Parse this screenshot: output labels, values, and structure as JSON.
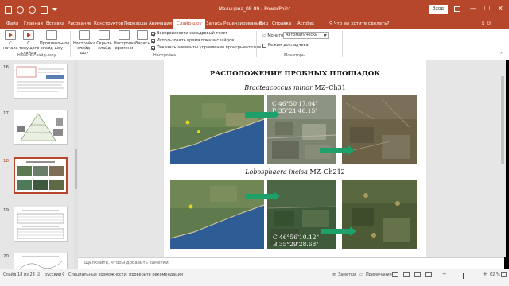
{
  "window": {
    "title": "Мальцева_08.09  -  PowerPoint",
    "signin_label": "Вход",
    "minimize": "—",
    "maximize": "☐",
    "close": "✕"
  },
  "tabs": [
    {
      "label": "Файл"
    },
    {
      "label": "Главная"
    },
    {
      "label": "Вставка"
    },
    {
      "label": "Рисование"
    },
    {
      "label": "Конструктор"
    },
    {
      "label": "Переходы"
    },
    {
      "label": "Анимация"
    },
    {
      "label": "Слайд-шоу",
      "active": true
    },
    {
      "label": "Запись"
    },
    {
      "label": "Рецензирование"
    },
    {
      "label": "Вид"
    },
    {
      "label": "Справка"
    },
    {
      "label": "Acrobat"
    }
  ],
  "tell_me": "Что вы хотите сделать?",
  "ribbon": {
    "start_group": {
      "label": "Начать слайд-шоу",
      "from_start": "С начала",
      "from_current": "С текущего слайда",
      "custom": "Произвольное слайд-шоу"
    },
    "setup_group": {
      "label": "Настройка",
      "setup": "Настройка слайд-шоу",
      "hide": "Скрыть слайд",
      "rehearse": "Настройка времени",
      "record": "Запись",
      "checkboxes": [
        {
          "label": "Воспроизвести закадровый текст",
          "checked": true
        },
        {
          "label": "Использовать время показа слайдов",
          "checked": true
        },
        {
          "label": "Показать элементы управления проигрывателем",
          "checked": true
        }
      ]
    },
    "monitors_group": {
      "label": "Мониторы",
      "monitor_label": "Монитор:",
      "monitor_value": "Автоматически",
      "presenter_view": "Режим докладчика",
      "presenter_checked": false
    }
  },
  "slides": [
    {
      "number": "16"
    },
    {
      "number": "17"
    },
    {
      "number": "18",
      "selected": true
    },
    {
      "number": "19"
    },
    {
      "number": "20"
    }
  ],
  "slide": {
    "title": "РАСПОЛОЖЕНИЕ ПРОБНЫХ ПЛОЩАДОК",
    "species1_name": "Bracteacoccus minor",
    "species1_code": " MZ–Ch31",
    "coords1_lat": "С 46°50'17.04\"",
    "coords1_lon": "В 35°21'46.15\"",
    "species2_name": "Lobosphaera incisa",
    "species2_code": " MZ–Ch212",
    "coords2_lat": "С 46°56'10.12\"",
    "coords2_lon": "В 35°29'28.68\""
  },
  "notes_placeholder": "Щелкните, чтобы добавить заметки",
  "status": {
    "slide_counter": "Слайд 18 из 23",
    "language": "русский",
    "accessibility": "Специальные возможности: проверьте рекомендации",
    "notes_btn": "Заметки",
    "comments_btn": "Примечания",
    "zoom_minus": "−",
    "zoom_plus": "+",
    "zoom": "62 %"
  }
}
